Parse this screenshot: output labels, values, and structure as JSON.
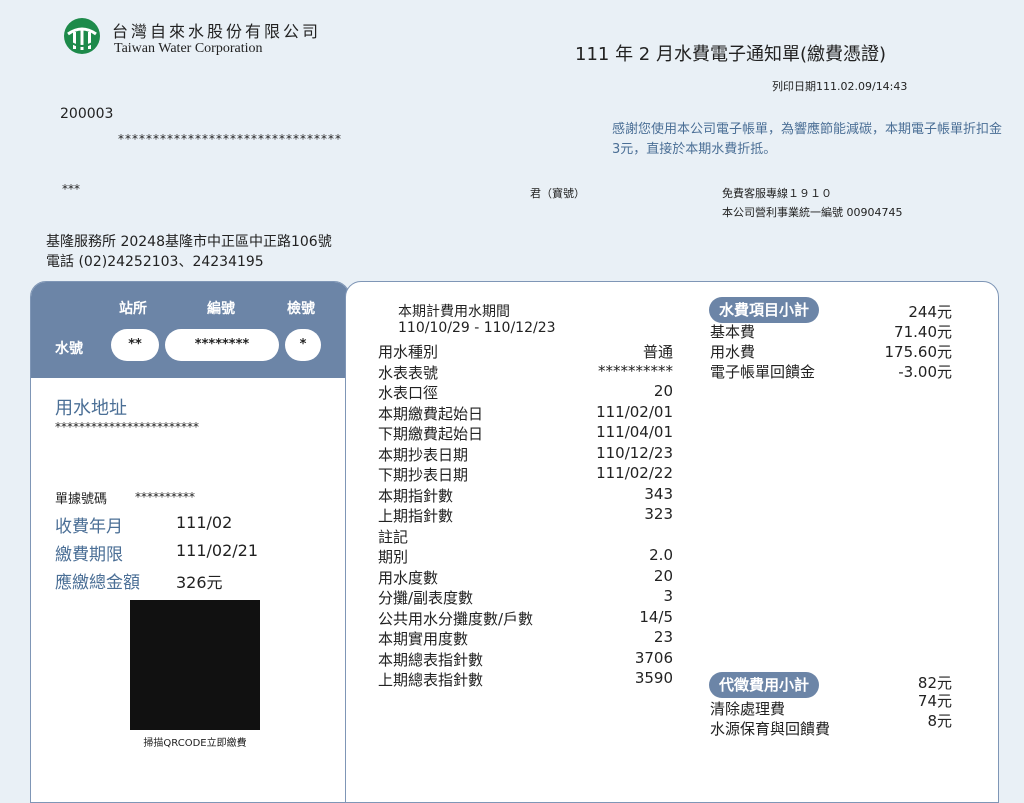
{
  "header": {
    "company_zh": "台灣自來水股份有限公司",
    "company_en": "Taiwan Water Corporation",
    "title": "111 年 2 月水費電子通知單(繳費憑證)",
    "print_date": "列印日期111.02.09/14:43"
  },
  "customer": {
    "code": "200003",
    "masked_line": "********************************",
    "name": "***",
    "honorific": "君（寶號）"
  },
  "notice": "感謝您使用本公司電子帳單，為響應節能減碳，本期電子帳單折扣金3元，直接於本期水費折抵。",
  "contact": {
    "hotline": "免費客服專線１９１０",
    "tax_id": "本公司營利事業統一編號 00904745"
  },
  "office": {
    "address": "基隆服務所  20248基隆市中正區中正路106號",
    "phone": "電話 (02)24252103、24234195"
  },
  "meter": {
    "col_station": "站所",
    "col_number": "編號",
    "col_check": "檢號",
    "row_label": "水號",
    "station": "**",
    "number": "********",
    "check": "*"
  },
  "left": {
    "address_label": "用水地址",
    "address_value": "************************",
    "doc_no_label": "單據號碼",
    "doc_no_value": "**********",
    "month_label": "收費年月",
    "month_value": "111/02",
    "due_label": "繳費期限",
    "due_value": "111/02/21",
    "total_label": "應繳總金額",
    "total_value": "326元",
    "qr_caption": "掃描QRCODE立即繳費"
  },
  "period": {
    "label": "本期計費用水期間",
    "range": "110/10/29 -  110/12/23"
  },
  "details": [
    {
      "label": "用水種別",
      "value": "普通"
    },
    {
      "label": "水表表號",
      "value": "**********"
    },
    {
      "label": "水表口徑",
      "value": "20"
    },
    {
      "label": "本期繳費起始日",
      "value": "111/02/01"
    },
    {
      "label": "下期繳費起始日",
      "value": "111/04/01"
    },
    {
      "label": "本期抄表日期",
      "value": "110/12/23"
    },
    {
      "label": "下期抄表日期",
      "value": "111/02/22"
    },
    {
      "label": "本期指針數",
      "value": "343"
    },
    {
      "label": "上期指針數",
      "value": "323"
    },
    {
      "label": "註記",
      "value": ""
    },
    {
      "label": "期別",
      "value": "2.0"
    },
    {
      "label": "用水度數",
      "value": "20"
    },
    {
      "label": "分攤/副表度數",
      "value": "3"
    },
    {
      "label": "公共用水分攤度數/戶數",
      "value": "14/5"
    },
    {
      "label": "本期實用度數",
      "value": "23"
    },
    {
      "label": "本期總表指針數",
      "value": "3706"
    },
    {
      "label": "上期總表指針數",
      "value": "3590"
    }
  ],
  "water_fee": {
    "title": "水費項目小計",
    "total": "244元",
    "items": [
      {
        "label": "基本費",
        "value": "71.40元"
      },
      {
        "label": "用水費",
        "value": "175.60元"
      },
      {
        "label": "電子帳單回饋金",
        "value": "-3.00元"
      }
    ]
  },
  "agency_fee": {
    "title": "代徵費用小計",
    "total": "82元",
    "items": [
      {
        "label": "清除處理費",
        "value": "74元"
      },
      {
        "label": "水源保育與回饋費",
        "value": "8元"
      }
    ]
  },
  "colors": {
    "accent": "#6c85a7",
    "notice_text": "#4b6f96",
    "logo_green": "#1d8a4a"
  }
}
